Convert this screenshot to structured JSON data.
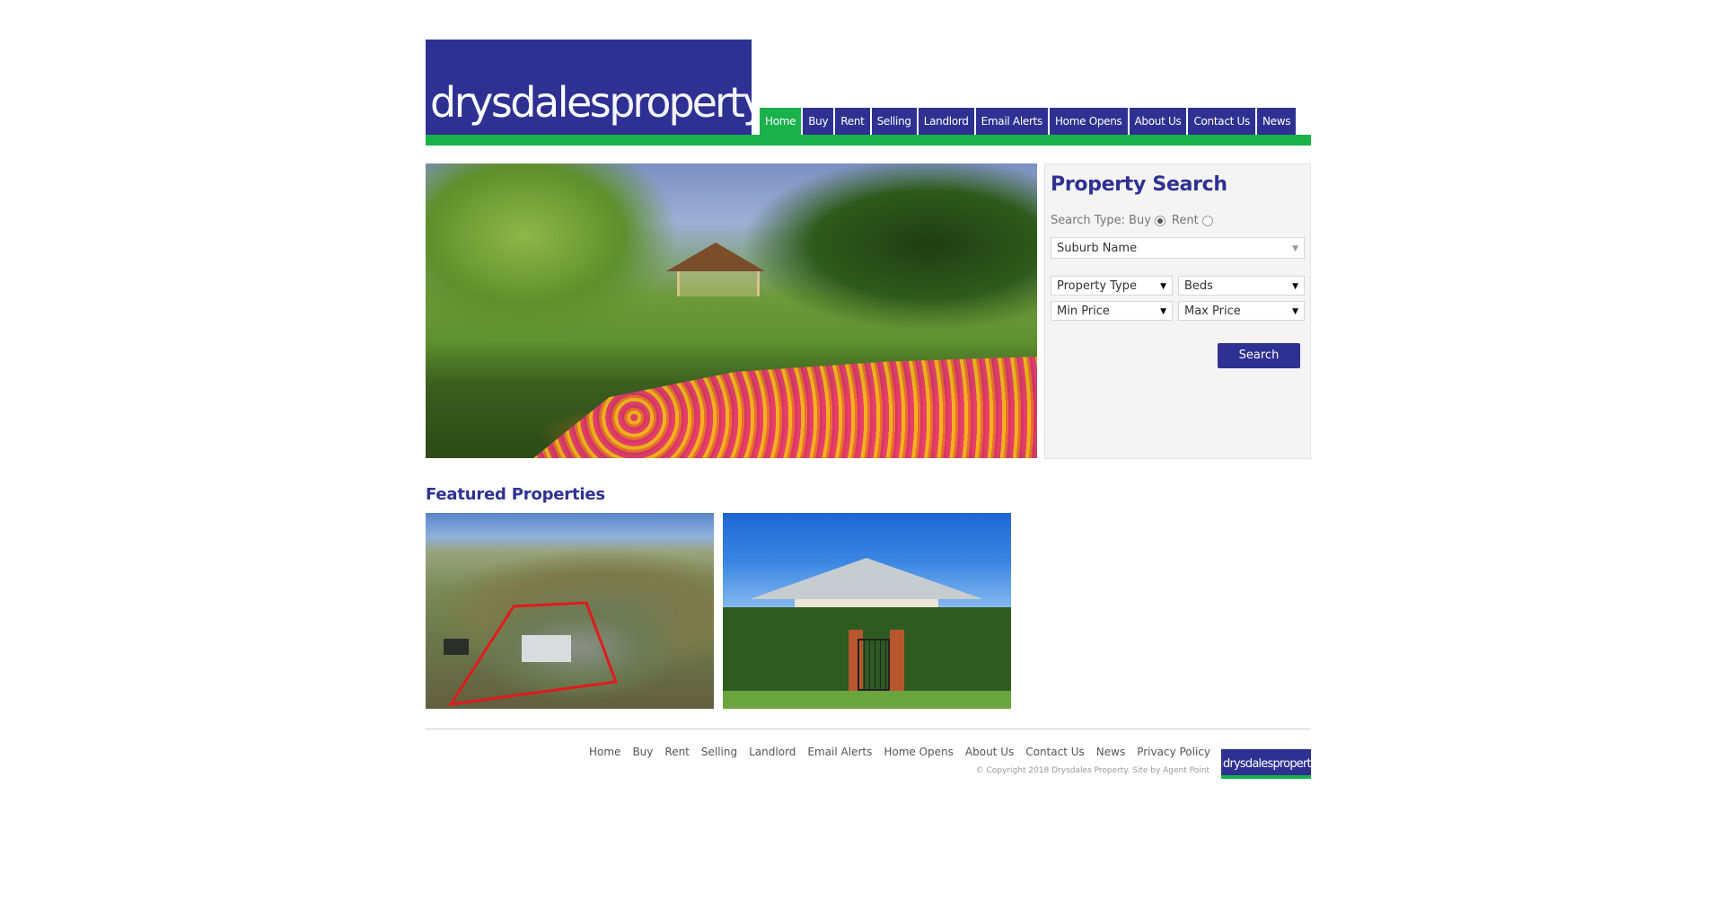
{
  "brand": {
    "logo_part1": "drysdales",
    "logo_part2": "property",
    "primary_color": "#2e3192",
    "accent_color": "#19b14a"
  },
  "nav": {
    "items": [
      "Home",
      "Buy",
      "Rent",
      "Selling",
      "Landlord",
      "Email Alerts",
      "Home Opens",
      "About Us",
      "Contact Us",
      "News"
    ],
    "active": "Home"
  },
  "search": {
    "title": "Property Search",
    "search_type_label": "Search Type:",
    "type_buy": "Buy",
    "type_rent": "Rent",
    "selected_type": "Buy",
    "suburb": "Suburb Name",
    "property_type": "Property Type",
    "beds": "Beds",
    "min_price": "Min Price",
    "max_price": "Max Price",
    "button": "Search"
  },
  "featured": {
    "title": "Featured Properties"
  },
  "footer": {
    "links": [
      "Home",
      "Buy",
      "Rent",
      "Selling",
      "Landlord",
      "Email Alerts",
      "Home Opens",
      "About Us",
      "Contact Us",
      "News",
      "Privacy Policy"
    ],
    "copyright": "© Copyright 2018 Drysdales Property. Site by Agent Point",
    "logo_part1": "drysdales",
    "logo_part2": "property"
  }
}
